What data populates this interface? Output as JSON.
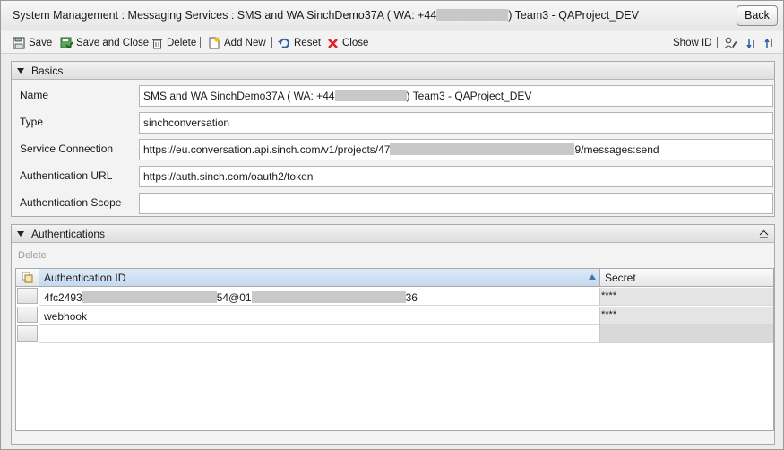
{
  "window": {
    "title_start": "System Management : Messaging Services : SMS and  WA SinchDemo37A ( WA: +44",
    "title_end": ") Team3 -  QAProject_DEV",
    "back_label": "Back"
  },
  "toolbar": {
    "save": "Save",
    "save_close": "Save and Close",
    "delete": "Delete",
    "add_new": "Add New",
    "reset": "Reset",
    "close": "Close",
    "show_id": "Show ID"
  },
  "basics": {
    "title": "Basics",
    "name_label": "Name",
    "name_start": "SMS and  WA SinchDemo37A ( WA: +44",
    "name_end": ") Team3 -  QAProject_DEV",
    "type_label": "Type",
    "type_value": "sinchconversation",
    "conn_label": "Service Connection",
    "conn_start": "https://eu.conversation.api.sinch.com/v1/projects/47",
    "conn_end": "9/messages:send",
    "auth_url_label": "Authentication URL",
    "auth_url_value": "https://auth.sinch.com/oauth2/token",
    "auth_scope_label": "Authentication Scope",
    "auth_scope_value": ""
  },
  "auths": {
    "title": "Authentications",
    "delete_label": "Delete",
    "col_id": "Authentication ID",
    "col_secret": "Secret",
    "rows": [
      {
        "id_a": "4fc2493",
        "id_b": "54@01",
        "id_c": "36",
        "secret": "****"
      },
      {
        "id": "webhook",
        "secret": "****"
      }
    ]
  }
}
